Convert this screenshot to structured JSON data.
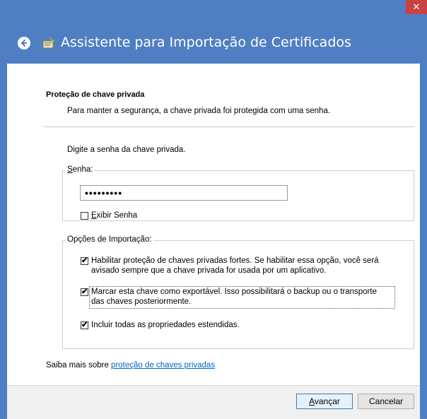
{
  "window": {
    "title": "Assistente para Importação de Certificados",
    "close_symbol": "✕",
    "back_symbol": "➔"
  },
  "page": {
    "section_title": "Proteção de chave privada",
    "section_desc": "Para manter a segurança, a chave privada foi protegida com uma senha.",
    "instruction": "Digite a senha da chave privada."
  },
  "password_group": {
    "legend": "Senha:",
    "value": "•••••••••",
    "show_password_label": "Exibir Senha",
    "show_password_checked": false
  },
  "import_group": {
    "legend": "Opções de Importação:",
    "options": [
      {
        "label_line1": "Habilitar proteção de chaves privadas fortes. Se habilitar essa opção, você será",
        "label_line2": "avisado sempre que a chave privada for usada por um aplicativo.",
        "checked": true
      },
      {
        "label_line1": "Marcar esta chave como exportável. Isso possibilitará o backup ou o transporte",
        "label_line2": "das chaves posteriormente.",
        "checked": true
      },
      {
        "label_line1": "Incluir todas as propriedades estendidas.",
        "label_line2": "",
        "checked": true
      }
    ]
  },
  "learn_more": {
    "prefix": "Saiba mais sobre ",
    "link": "proteção de chaves privadas"
  },
  "buttons": {
    "next": "Avançar",
    "cancel": "Cancelar"
  },
  "colors": {
    "titlebar": "#4f7fc2",
    "close": "#c74343",
    "link": "#0066cc"
  }
}
